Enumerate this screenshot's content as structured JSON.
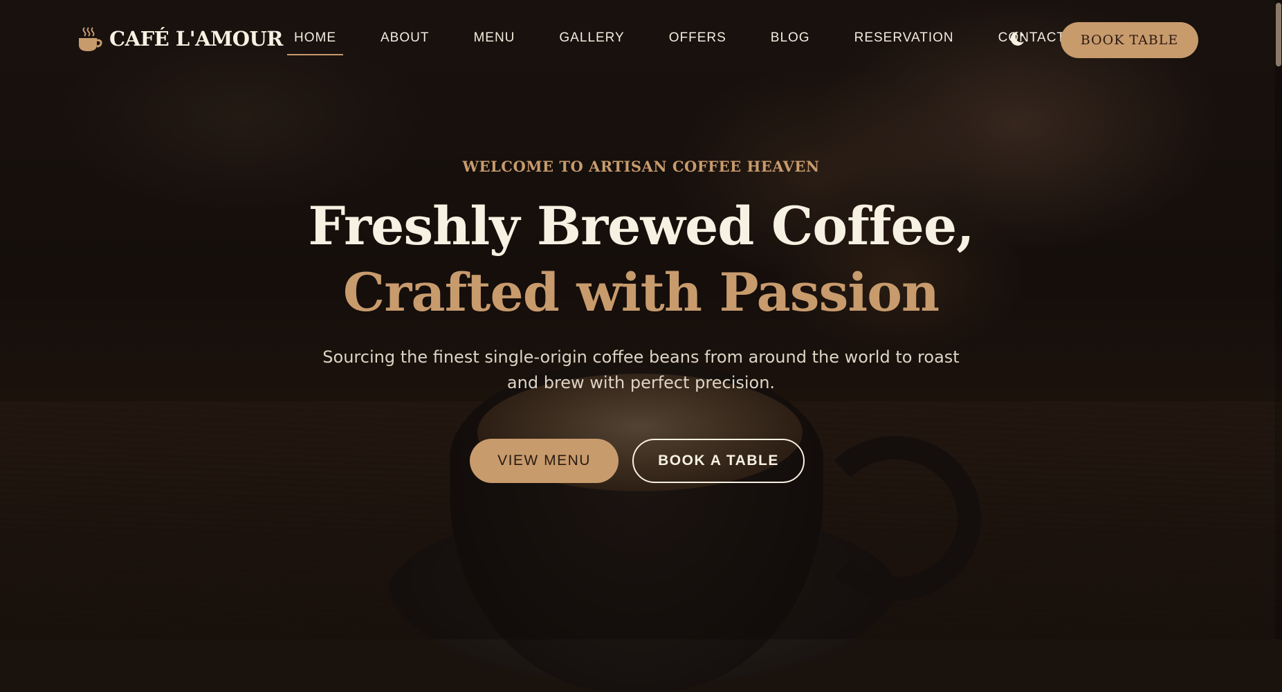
{
  "brand": {
    "name": "CAFÉ L'AMOUR",
    "icon": "coffee-cup-icon",
    "accent": "#c89b6d"
  },
  "nav": {
    "items": [
      {
        "label": "HOME",
        "active": true
      },
      {
        "label": "ABOUT"
      },
      {
        "label": "MENU"
      },
      {
        "label": "GALLERY"
      },
      {
        "label": "OFFERS"
      },
      {
        "label": "BLOG"
      },
      {
        "label": "RESERVATION"
      },
      {
        "label": "CONTACT"
      }
    ],
    "theme_toggle_icon": "moon-stars-icon",
    "book_label": "BOOK TABLE"
  },
  "hero": {
    "kicker": "WELCOME TO ARTISAN COFFEE HEAVEN",
    "title_line1": "Freshly Brewed Coffee,",
    "title_line2": "Crafted with Passion",
    "subtitle_line1": "Sourcing the finest single-origin coffee beans from around the world to roast",
    "subtitle_line2": "and brew with perfect precision.",
    "primary_cta": "VIEW MENU",
    "secondary_cta": "BOOK A TABLE"
  }
}
